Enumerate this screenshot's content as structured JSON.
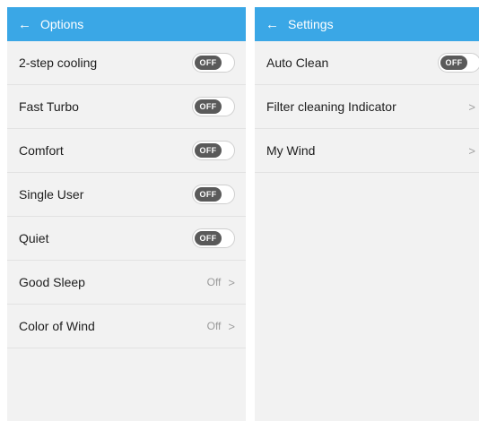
{
  "left_screen": {
    "title": "Options",
    "rows": [
      {
        "label": "2-step cooling",
        "state": "OFF"
      },
      {
        "label": "Fast Turbo",
        "state": "OFF"
      },
      {
        "label": "Comfort",
        "state": "OFF"
      },
      {
        "label": "Single User",
        "state": "OFF"
      },
      {
        "label": "Quiet",
        "state": "OFF"
      },
      {
        "label": "Good Sleep",
        "value": "Off"
      },
      {
        "label": "Color of Wind",
        "value": "Off"
      }
    ]
  },
  "right_screen": {
    "title": "Settings",
    "rows": [
      {
        "label": "Auto Clean",
        "state": "OFF"
      },
      {
        "label": "Filter cleaning Indicator"
      },
      {
        "label": "My Wind"
      }
    ]
  },
  "icons": {
    "back": "arrow-left-icon",
    "chevron": "chevron-right-icon"
  },
  "colors": {
    "appbar": "#3aa7e6",
    "background": "#f2f2f2",
    "toggle_off_knob": "#5a5a5a"
  }
}
